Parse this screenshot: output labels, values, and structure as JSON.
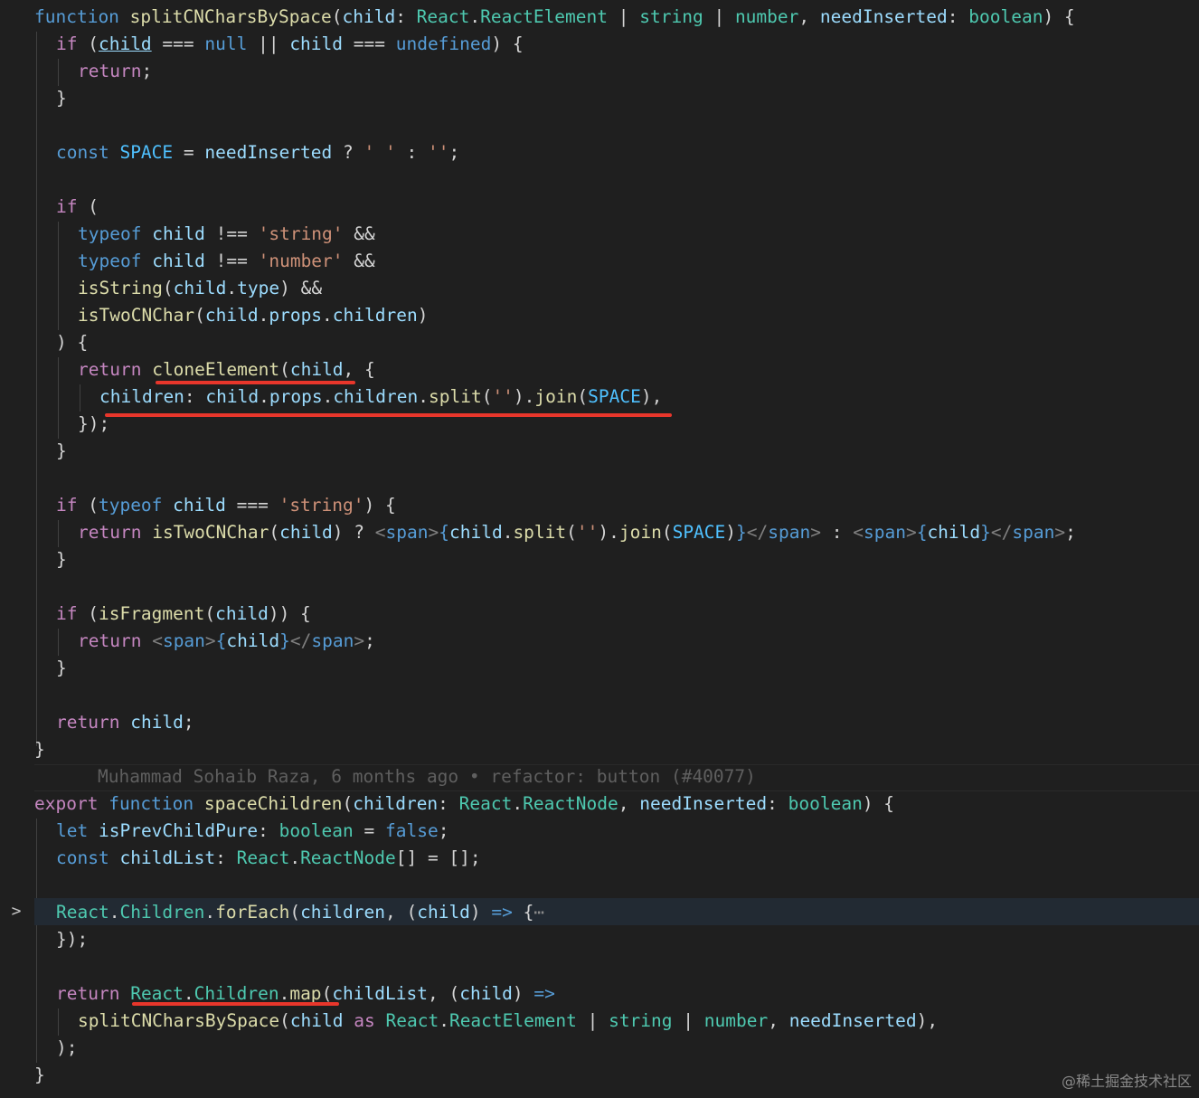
{
  "code": {
    "l1_kw": "function",
    "l1_fn": "splitCNCharsBySpace",
    "l1_p1": "child",
    "l1_t1a": "React",
    "l1_t1b": "ReactElement",
    "l1_t2": "string",
    "l1_t3": "number",
    "l1_p2": "needInserted",
    "l1_t4": "boolean",
    "l2_if": "if",
    "l2_child": "child",
    "l2_null": "null",
    "l2_child2": "child",
    "l2_undef": "undefined",
    "l3_return": "return",
    "l6_const": "const",
    "l6_space": "SPACE",
    "l6_ni": "needInserted",
    "l6_s1": "' '",
    "l6_s2": "''",
    "l8_if": "if",
    "l9_typeof": "typeof",
    "l9_child": "child",
    "l9_str": "'string'",
    "l10_typeof": "typeof",
    "l10_child": "child",
    "l10_str": "'number'",
    "l11_fn": "isString",
    "l11_child": "child",
    "l11_prop": "type",
    "l12_fn": "isTwoCNChar",
    "l12_child": "child",
    "l12_props": "props",
    "l12_children": "children",
    "l14_return": "return",
    "l14_fn": "cloneElement",
    "l14_child": "child",
    "l15_children": "children",
    "l15_child": "child",
    "l15_props": "props",
    "l15_children2": "children",
    "l15_split": "split",
    "l15_str": "''",
    "l15_join": "join",
    "l15_space": "SPACE",
    "l19_if": "if",
    "l19_typeof": "typeof",
    "l19_child": "child",
    "l19_str": "'string'",
    "l20_return": "return",
    "l20_fn": "isTwoCNChar",
    "l20_child": "child",
    "l20_span": "span",
    "l20_child2": "child",
    "l20_split": "split",
    "l20_str": "''",
    "l20_join": "join",
    "l20_space": "SPACE",
    "l20_span2": "span",
    "l20_span3": "span",
    "l20_child3": "child",
    "l20_span4": "span",
    "l23_if": "if",
    "l23_fn": "isFragment",
    "l23_child": "child",
    "l24_return": "return",
    "l24_span": "span",
    "l24_child": "child",
    "l24_span2": "span",
    "l27_return": "return",
    "l27_child": "child",
    "l30_export": "export",
    "l30_function": "function",
    "l30_fn": "spaceChildren",
    "l30_p1": "children",
    "l30_t1a": "React",
    "l30_t1b": "ReactNode",
    "l30_p2": "needInserted",
    "l30_t2": "boolean",
    "l31_let": "let",
    "l31_var": "isPrevChildPure",
    "l31_type": "boolean",
    "l31_false": "false",
    "l32_const": "const",
    "l32_var": "childList",
    "l32_ta": "React",
    "l32_tb": "ReactNode",
    "l34_react": "React",
    "l34_children": "Children",
    "l34_fn": "forEach",
    "l34_p1": "children",
    "l34_p2": "child",
    "l34_ellipsis": "⋯",
    "l37_return": "return",
    "l37_react": "React",
    "l37_children": "Children",
    "l37_fn": "map",
    "l37_p1": "childList",
    "l37_p2": "child",
    "l38_fn": "splitCNCharsBySpace",
    "l38_child": "child",
    "l38_as": "as",
    "l38_ta": "React",
    "l38_tb": "ReactElement",
    "l38_t2": "string",
    "l38_t3": "number",
    "l38_ni": "needInserted"
  },
  "blame": "Muhammad Sohaib Raza, 6 months ago • refactor: button (#40077)",
  "fold_icon": "chevron-right-icon",
  "watermark": "@稀土掘金技术社区",
  "colors": {
    "background": "#1f1f1f",
    "keyword": "#569cd6",
    "control": "#c586c0",
    "function": "#dcdcaa",
    "variable": "#9cdcfe",
    "type": "#4ec9b0",
    "string": "#ce9178",
    "constant": "#4fc1ff",
    "annotation": "#e8362b"
  }
}
